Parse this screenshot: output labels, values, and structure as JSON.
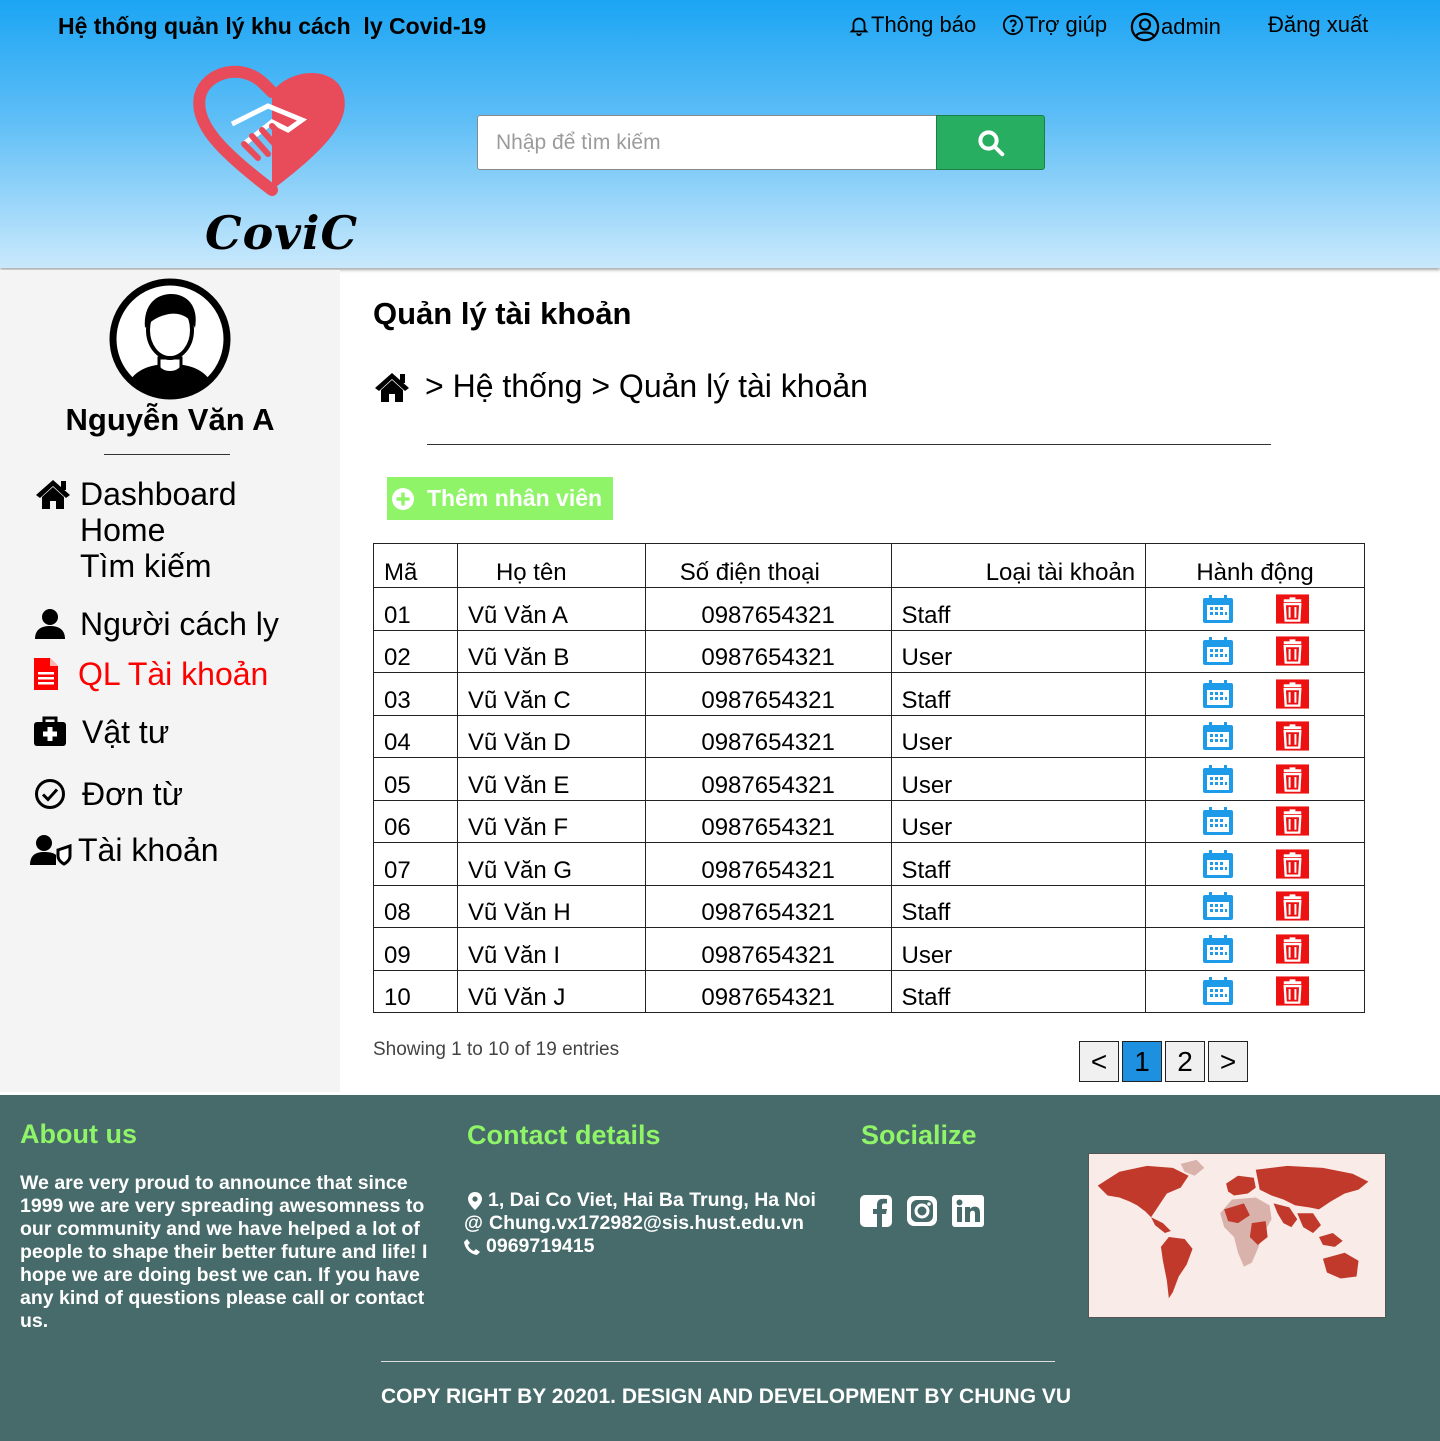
{
  "header": {
    "app_title": "Hệ thống quản lý khu cách  ly Covid-19",
    "links": {
      "notifications": "Thông báo",
      "help": "Trợ giúp",
      "user": "admin",
      "logout": "Đăng xuất"
    },
    "logo_text": "CoviC",
    "search_placeholder": "Nhập để tìm kiếm",
    "icons": [
      "bell-icon",
      "question-circle-icon",
      "user-circle-icon",
      "search-icon"
    ],
    "colors": {
      "header_top": "#1ba5f4",
      "search_button": "#27ae60",
      "logo_heart": "#e84c5a"
    }
  },
  "sidebar": {
    "user_name": "Nguyễn Văn A",
    "items": [
      {
        "label": "Dashboard",
        "icon": "home-icon"
      },
      {
        "label": "Home"
      },
      {
        "label": "Tìm kiếm"
      },
      {
        "label": "Người cách ly",
        "icon": "user-icon"
      },
      {
        "label": "QL Tài khoản",
        "icon": "file-icon",
        "active": true
      },
      {
        "label": "Vật tư",
        "icon": "medkit-icon"
      },
      {
        "label": "Đơn từ",
        "icon": "check-circle-icon"
      },
      {
        "label": "Tài khoản",
        "icon": "user-shield-icon"
      }
    ],
    "active_color": "#ff0000"
  },
  "main": {
    "page_title": "Quản lý tài khoản",
    "breadcrumb": "> Hệ thống > Quản lý tài khoản",
    "add_button": "Thêm nhân viên",
    "table": {
      "headers": [
        "Mã",
        "Họ tên",
        "Số điện thoại",
        "Loại tài khoản",
        "Hành động"
      ],
      "rows": [
        [
          "01",
          "Vũ Văn A",
          "0987654321",
          "Staff"
        ],
        [
          "02",
          "Vũ Văn B",
          "0987654321",
          "User"
        ],
        [
          "03",
          "Vũ Văn C",
          "0987654321",
          "Staff"
        ],
        [
          "04",
          "Vũ Văn D",
          "0987654321",
          "User"
        ],
        [
          "05",
          "Vũ Văn E",
          "0987654321",
          "User"
        ],
        [
          "06",
          "Vũ Văn F",
          "0987654321",
          "User"
        ],
        [
          "07",
          "Vũ Văn G",
          "0987654321",
          "Staff"
        ],
        [
          "08",
          "Vũ Văn H",
          "0987654321",
          "Staff"
        ],
        [
          "09",
          "Vũ Văn I",
          "0987654321",
          "User"
        ],
        [
          "10",
          "Vũ Văn J",
          "0987654321",
          "Staff"
        ]
      ],
      "action_icons": [
        "calendar-icon",
        "trash-icon"
      ]
    },
    "entries_info": "Showing 1 to 10 of 19 entries",
    "pagination": {
      "prev": "<",
      "pages": [
        "1",
        "2"
      ],
      "next": ">",
      "current": "1"
    }
  },
  "footer": {
    "about_title": "About us",
    "about_text": "We are very proud to announce that since 1999 we are very spreading awesomness to our community and we have helped a lot of people to shape their better future and life! I hope we are doing best we can. If you have any kind of questions please call or contact us.",
    "contact_title": "Contact details",
    "address": "1, Dai Co Viet, Hai Ba Trung, Ha Noi",
    "email": "Chung.vx172982@sis.hust.edu.vn",
    "phone": "0969719415",
    "social_title": "Socialize",
    "social_icons": [
      "facebook-icon",
      "instagram-icon",
      "linkedin-icon"
    ],
    "copyright": "COPY RIGHT BY 20201. DESIGN AND DEVELOPMENT BY CHUNG VU",
    "colors": {
      "background": "#476b6a",
      "heading": "#8ff467"
    }
  }
}
